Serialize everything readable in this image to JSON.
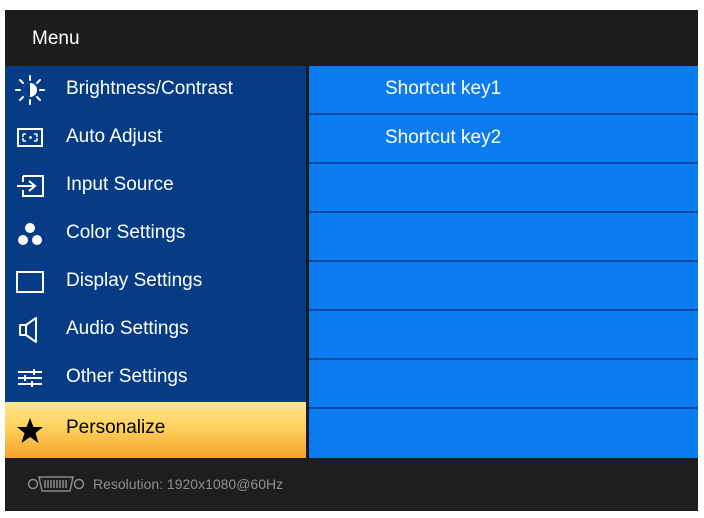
{
  "menu": {
    "title": "Menu"
  },
  "sidebar": {
    "items": [
      {
        "label": "Brightness/Contrast",
        "icon": "brightness-icon"
      },
      {
        "label": "Auto Adjust",
        "icon": "auto-adjust-icon"
      },
      {
        "label": "Input Source",
        "icon": "input-source-icon"
      },
      {
        "label": "Color Settings",
        "icon": "color-settings-icon"
      },
      {
        "label": "Display Settings",
        "icon": "display-settings-icon"
      },
      {
        "label": "Audio Settings",
        "icon": "speaker-icon"
      },
      {
        "label": "Other Settings",
        "icon": "sliders-icon"
      },
      {
        "label": "Personalize",
        "icon": "star-icon",
        "selected": true
      }
    ]
  },
  "submenu": {
    "rows": [
      {
        "label": "Shortcut key1"
      },
      {
        "label": "Shortcut key2"
      },
      {
        "label": ""
      },
      {
        "label": ""
      },
      {
        "label": ""
      },
      {
        "label": ""
      },
      {
        "label": ""
      },
      {
        "label": ""
      }
    ]
  },
  "footer": {
    "resolution": "Resolution:  1920x1080@60Hz",
    "icon": "vga-connector-icon"
  },
  "colors": {
    "sidebar_bg": "#063c86",
    "submenu_bg": "#0a7cf0",
    "selected_top": "#ffe58c",
    "selected_bottom": "#f3a22a",
    "titlebar_bg": "#1c1c1c"
  }
}
